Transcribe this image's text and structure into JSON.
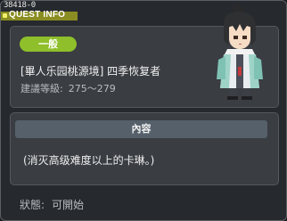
{
  "window": {
    "quest_id": "38418-0",
    "title": "QUEST INFO"
  },
  "info": {
    "category": "一般",
    "quest_name": "[畢人乐园桃源境] 四季恢复者",
    "level_label": "建議等級:",
    "level_range": "275～279"
  },
  "content": {
    "header": "內容",
    "text": "(消灭高级难度以上的卡琳。)"
  },
  "status": {
    "label": "狀態:",
    "value": "可開始"
  },
  "colors": {
    "title_bar": "#8a8d22",
    "category_badge": "#8fbf2a",
    "panel": "#3a3d42",
    "content_header": "#55606a"
  },
  "icons": {
    "npc_portrait": "npc-character-portrait"
  }
}
